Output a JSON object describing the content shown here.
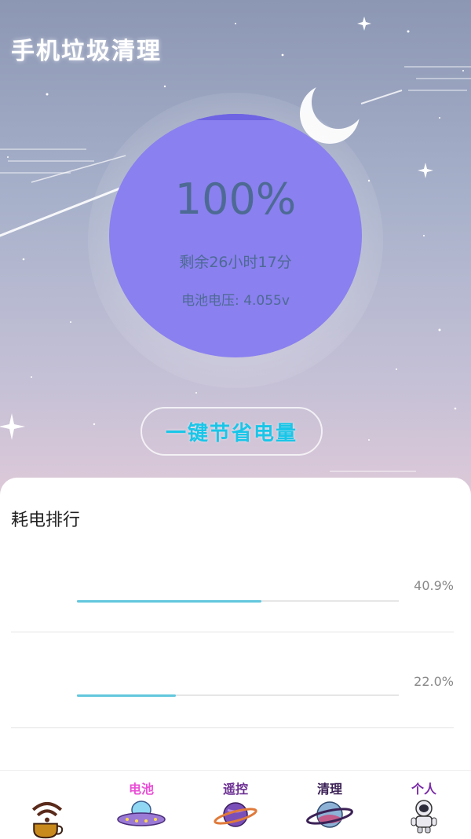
{
  "header": {
    "title": "手机垃圾清理"
  },
  "battery": {
    "percent": "100%",
    "remaining": "剩余26小时17分",
    "voltage": "电池电压: 4.055v",
    "level": 1.0
  },
  "save_button": {
    "label": "一键节省电量"
  },
  "ranking": {
    "title": "耗电排行",
    "items": [
      {
        "percent_label": "40.9%",
        "value": 0.409
      },
      {
        "percent_label": "22.0%",
        "value": 0.22
      }
    ]
  },
  "nav": {
    "items": [
      {
        "label": "",
        "icon": "wifi-coffee-icon"
      },
      {
        "label": "电池",
        "icon": "ufo-icon",
        "color": "#e94fd6"
      },
      {
        "label": "遥控",
        "icon": "planet-icon",
        "color": "#6a2d91"
      },
      {
        "label": "清理",
        "icon": "ringed-planet-icon",
        "color": "#3b2156"
      },
      {
        "label": "个人",
        "icon": "astronaut-icon",
        "color": "#7a2aa8"
      }
    ]
  },
  "colors": {
    "gauge_fill": "#8a80ef",
    "gauge_text": "#4d6a94",
    "button_text": "#19c6e8",
    "progress_bar": "#62c7de"
  }
}
